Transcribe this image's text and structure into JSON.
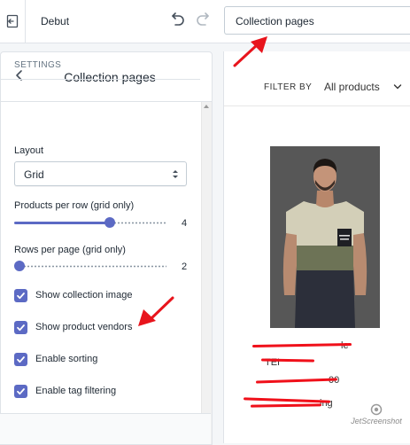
{
  "topbar": {
    "exit_icon": "exit-editor-icon",
    "theme_name": "Debut",
    "undo_icon": "undo-icon",
    "redo_icon": "redo-icon",
    "page_selector": "Collection pages"
  },
  "sidebar": {
    "title": "Collection pages",
    "back_icon": "chevron-left-icon",
    "section": "SETTINGS",
    "layout": {
      "label": "Layout",
      "value": "Grid"
    },
    "products_per_row": {
      "label": "Products per row (grid only)",
      "value": "4",
      "min": 2,
      "max": 4,
      "level": 0.63
    },
    "rows_per_page": {
      "label": "Rows per page (grid only)",
      "value": "2",
      "level": 0.0
    },
    "checkboxes": [
      {
        "label": "Show collection image",
        "checked": true
      },
      {
        "label": "Show product vendors",
        "checked": true
      },
      {
        "label": "Enable sorting",
        "checked": true
      },
      {
        "label": "Enable tag filtering",
        "checked": true
      }
    ]
  },
  "preview": {
    "filter_label": "FILTER BY",
    "filter_value": "All products",
    "product_text": [
      "le",
      "TEI",
      "00",
      "ing"
    ]
  },
  "colors": {
    "accent": "#5c6ac4",
    "annotation": "#e8141c",
    "redaction": "#f0101a"
  },
  "watermark": "JetScreenshot"
}
